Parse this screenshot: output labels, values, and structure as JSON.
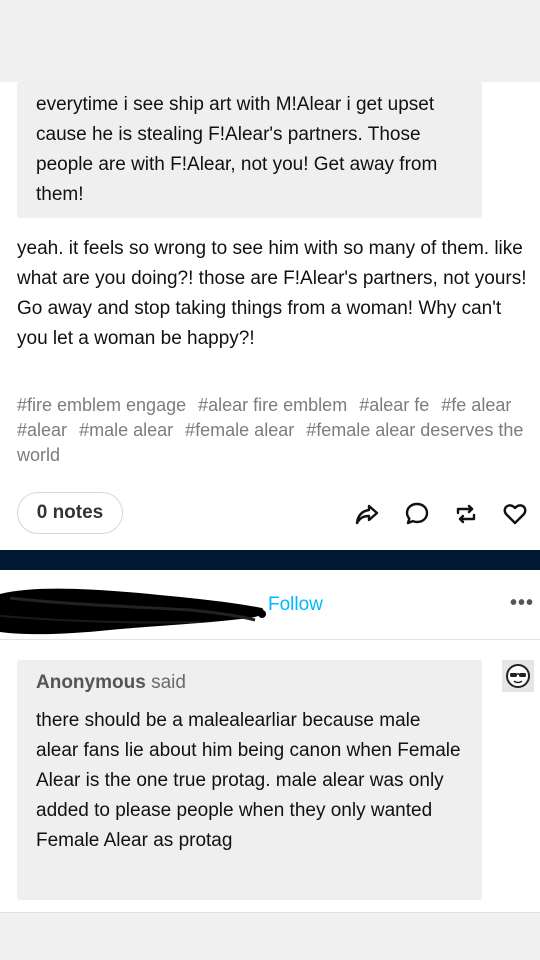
{
  "post1": {
    "quote_text": "everytime i see ship art with M!Alear i get upset cause he is stealing F!Alear's partners. Those people are with F!Alear, not you! Get away from them!",
    "body_text": "yeah. it feels so wrong to see him with so many of them. like what are you doing?! those are F!Alear's partners, not yours! Go away and stop taking things from a woman! Why can't you let a woman be happy?!",
    "tags": [
      "#fire emblem engage",
      "#alear fire emblem",
      "#alear fe",
      "#fe alear",
      "#alear",
      "#male alear",
      "#female alear",
      "#female alear deserves the world"
    ],
    "notes_label": "0 notes",
    "actions": [
      "share-icon",
      "reply-icon",
      "reblog-icon",
      "like-icon"
    ]
  },
  "post2": {
    "follow_label": "Follow",
    "more_label": "•••",
    "ask": {
      "asker": "Anonymous",
      "said": "said",
      "text": "there should be a malealearliar because male alear fans lie about him being canon when Female Alear is the one true protag. male alear was only added to please people when they only wanted Female Alear as protag"
    },
    "avatar_icon": "sunglasses-face-icon"
  },
  "colors": {
    "follow": "#00b8ff",
    "divider": "#001935",
    "tag": "#7c7c7c"
  }
}
